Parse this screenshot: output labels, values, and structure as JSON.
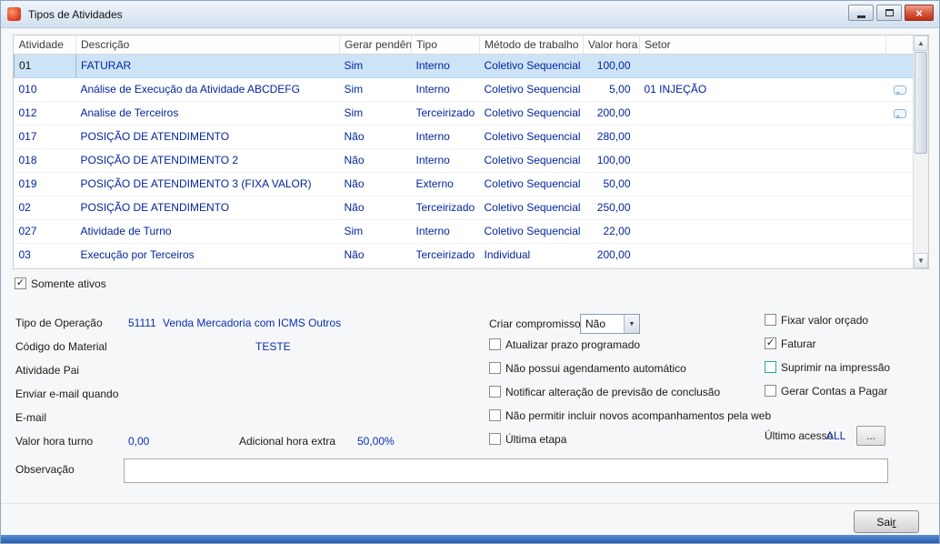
{
  "window": {
    "title": "Tipos de Atividades"
  },
  "icons": {
    "check": "✓",
    "combo_arrow": "▼",
    "scroll_up": "▲",
    "scroll_down": "▼",
    "close": "×"
  },
  "grid": {
    "columns": [
      {
        "key": "atividade",
        "label": "Atividade"
      },
      {
        "key": "descricao",
        "label": "Descrição"
      },
      {
        "key": "gerar_pendencia",
        "label": "Gerar pendência"
      },
      {
        "key": "tipo",
        "label": "Tipo"
      },
      {
        "key": "metodo",
        "label": "Método de trabalho"
      },
      {
        "key": "valor_hora",
        "label": "Valor hora"
      },
      {
        "key": "setor",
        "label": "Setor"
      }
    ],
    "rows": [
      {
        "atividade": "01",
        "descricao": "FATURAR",
        "gerar_pendencia": "Sim",
        "tipo": "Interno",
        "metodo": "Coletivo Sequencial",
        "valor_hora": "100,00",
        "setor": "",
        "selected": true,
        "editing": true,
        "has_note": false
      },
      {
        "atividade": "010",
        "descricao": "Análise de Execução da Atividade ABCDEFG",
        "gerar_pendencia": "Sim",
        "tipo": "Interno",
        "metodo": "Coletivo Sequencial",
        "valor_hora": "5,00",
        "setor": "01 INJEÇÃO",
        "selected": false,
        "editing": false,
        "has_note": true
      },
      {
        "atividade": "012",
        "descricao": "Analise de Terceiros",
        "gerar_pendencia": "Sim",
        "tipo": "Terceirizado",
        "metodo": "Coletivo Sequencial",
        "valor_hora": "200,00",
        "setor": "",
        "selected": false,
        "editing": false,
        "has_note": true
      },
      {
        "atividade": "017",
        "descricao": "POSIÇÃO DE ATENDIMENTO",
        "gerar_pendencia": "Não",
        "tipo": "Interno",
        "metodo": "Coletivo Sequencial",
        "valor_hora": "280,00",
        "setor": "",
        "selected": false,
        "editing": false,
        "has_note": false
      },
      {
        "atividade": "018",
        "descricao": "POSIÇÃO DE ATENDIMENTO 2",
        "gerar_pendencia": "Não",
        "tipo": "Interno",
        "metodo": "Coletivo Sequencial",
        "valor_hora": "100,00",
        "setor": "",
        "selected": false,
        "editing": false,
        "has_note": false
      },
      {
        "atividade": "019",
        "descricao": "POSIÇÃO DE ATENDIMENTO 3 (FIXA VALOR)",
        "gerar_pendencia": "Não",
        "tipo": "Externo",
        "metodo": "Coletivo Sequencial",
        "valor_hora": "50,00",
        "setor": "",
        "selected": false,
        "editing": false,
        "has_note": false
      },
      {
        "atividade": "02",
        "descricao": "POSIÇÃO DE ATENDIMENTO",
        "gerar_pendencia": "Não",
        "tipo": "Terceirizado",
        "metodo": "Coletivo Sequencial",
        "valor_hora": "250,00",
        "setor": "",
        "selected": false,
        "editing": false,
        "has_note": false
      },
      {
        "atividade": "027",
        "descricao": "Atividade de Turno",
        "gerar_pendencia": "Sim",
        "tipo": "Interno",
        "metodo": "Coletivo Sequencial",
        "valor_hora": "22,00",
        "setor": "",
        "selected": false,
        "editing": false,
        "has_note": false
      },
      {
        "atividade": "03",
        "descricao": "Execução por Terceiros",
        "gerar_pendencia": "Não",
        "tipo": "Terceirizado",
        "metodo": "Individual",
        "valor_hora": "200,00",
        "setor": "",
        "selected": false,
        "editing": false,
        "has_note": false
      }
    ]
  },
  "filter": {
    "somente_ativos_label": "Somente ativos",
    "somente_ativos_checked": true
  },
  "form": {
    "tipo_operacao": {
      "label": "Tipo de Operação",
      "code": "51111",
      "value": "Venda Mercadoria com ICMS Outros"
    },
    "codigo_material": {
      "label": "Código do Material",
      "value": "TESTE"
    },
    "atividade_pai": {
      "label": "Atividade Pai",
      "value": ""
    },
    "enviar_email_quando": {
      "label": "Enviar e-mail quando",
      "value": ""
    },
    "email": {
      "label": "E-mail",
      "value": ""
    },
    "valor_hora_turno": {
      "label": "Valor hora turno",
      "value": "0,00"
    },
    "adicional_hora_extra": {
      "label": "Adicional hora extra",
      "value": "50,00%"
    },
    "observacao": {
      "label": "Observação",
      "value": ""
    },
    "criar_compromisso": {
      "label": "Criar compromisso",
      "value": "Não"
    },
    "checkboxes_middle": [
      {
        "name": "atualizar-prazo-programado",
        "label": "Atualizar prazo programado",
        "checked": false,
        "highlight": false
      },
      {
        "name": "nao-possui-agendamento-automatico",
        "label": "Não possui agendamento automático",
        "checked": false,
        "highlight": false
      },
      {
        "name": "notificar-alteracao-previsao-conclusao",
        "label": "Notificar alteração de previsão de conclusão",
        "checked": false,
        "highlight": false
      },
      {
        "name": "nao-permitir-incluir-acompanhamentos-web",
        "label": "Não permitir incluir novos acompanhamentos pela web",
        "checked": false,
        "highlight": false
      },
      {
        "name": "ultima-etapa",
        "label": "Última etapa",
        "checked": false,
        "highlight": false
      }
    ],
    "checkboxes_right": [
      {
        "name": "fixar-valor-orcado",
        "label": "Fixar valor orçado",
        "checked": false,
        "highlight": false
      },
      {
        "name": "faturar",
        "label": "Faturar",
        "checked": true,
        "highlight": false
      },
      {
        "name": "suprimir-na-impressao",
        "label": "Suprimir na impressão",
        "checked": false,
        "highlight": true
      },
      {
        "name": "gerar-contas-a-pagar",
        "label": "Gerar Contas a Pagar",
        "checked": false,
        "highlight": false
      }
    ],
    "ultimo_acesso": {
      "label": "Último acesso",
      "value": "ALL",
      "button": "..."
    }
  },
  "footer": {
    "sair_prefix": "Sai",
    "sair_mnemonic": "r"
  }
}
